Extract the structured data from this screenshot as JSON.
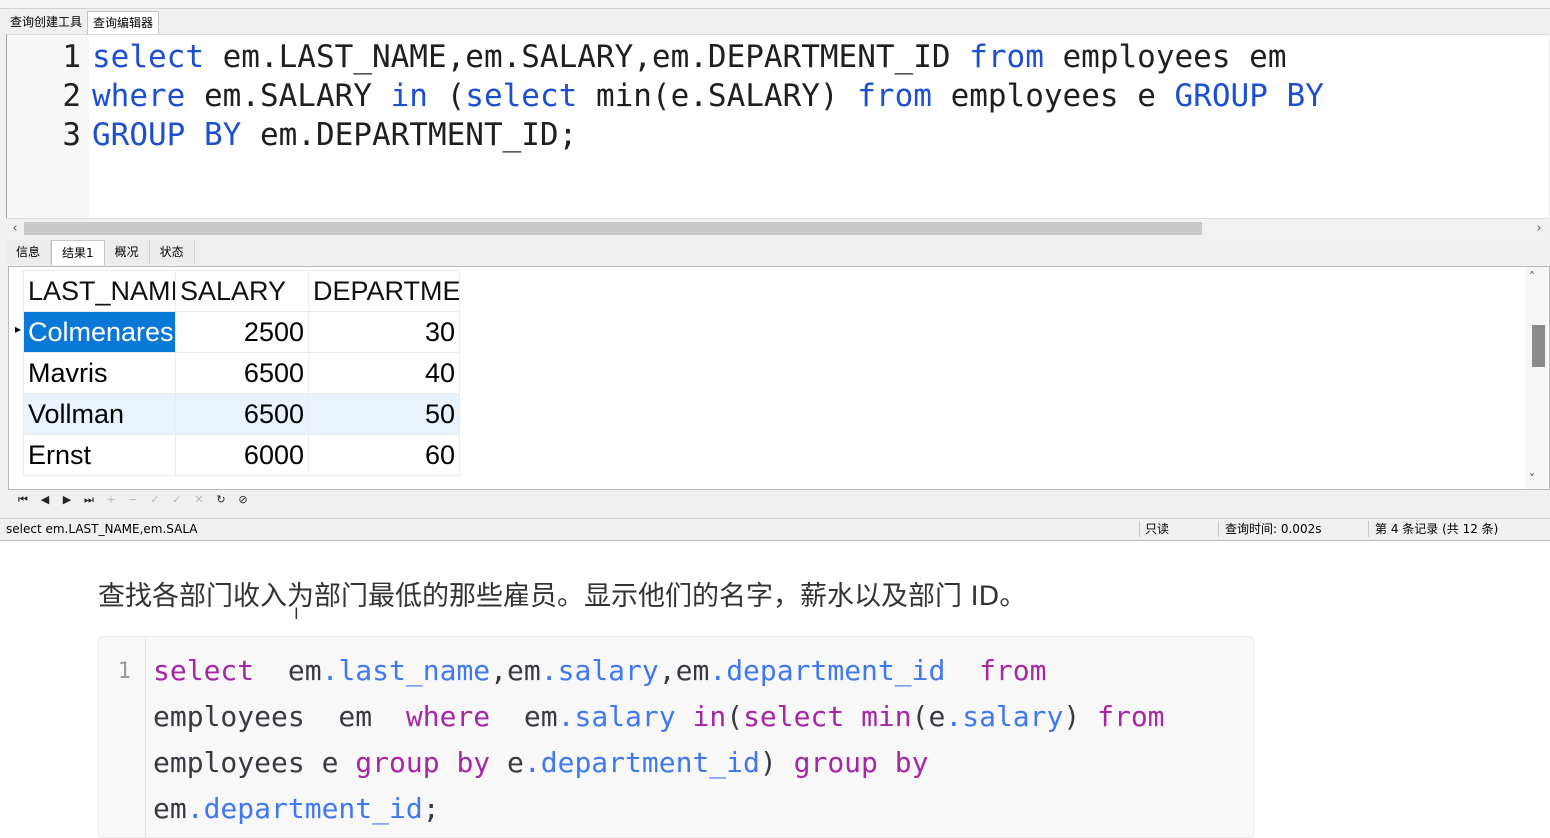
{
  "window": {
    "tabs": [
      "查询创建工具",
      "查询编辑器"
    ],
    "active_tab": 1
  },
  "editor": {
    "lines": [
      {
        "num": "1",
        "tokens": [
          {
            "t": "select",
            "k": true
          },
          {
            "t": " em.LAST_NAME,em.SALARY,em.DEPARTMENT_ID ",
            "k": false
          },
          {
            "t": "from",
            "k": true
          },
          {
            "t": " employees em",
            "k": false
          }
        ]
      },
      {
        "num": "2",
        "tokens": [
          {
            "t": "where",
            "k": true
          },
          {
            "t": " em.SALARY ",
            "k": false
          },
          {
            "t": "in",
            "k": true
          },
          {
            "t": " (",
            "k": false
          },
          {
            "t": "select",
            "k": true
          },
          {
            "t": " min(e.SALARY) ",
            "k": false
          },
          {
            "t": "from",
            "k": true
          },
          {
            "t": " employees e ",
            "k": false
          },
          {
            "t": "GROUP BY",
            "k": true
          }
        ]
      },
      {
        "num": "3",
        "tokens": [
          {
            "t": "GROUP BY",
            "k": true
          },
          {
            "t": " em.DEPARTMENT_ID;",
            "k": false
          }
        ]
      }
    ]
  },
  "result_tabs": [
    "信息",
    "结果1",
    "概况",
    "状态"
  ],
  "active_result_tab": 1,
  "grid": {
    "columns": [
      "LAST_NAMI",
      "SALARY",
      "DEPARTME"
    ],
    "rows": [
      [
        "Colmenares",
        "2500",
        "30"
      ],
      [
        "Mavris",
        "6500",
        "40"
      ],
      [
        "Vollman",
        "6500",
        "50"
      ],
      [
        "Ernst",
        "6000",
        "60"
      ]
    ]
  },
  "statusbar": {
    "sql": "select em.LAST_NAME,em.SALA",
    "mode": "只读",
    "query_time": "查询时间: 0.002s",
    "record": "第 4 条记录 (共 12 条)"
  },
  "article": {
    "description": "查找各部门收入为部门最低的那些雇员。显示他们的名字，薪水以及部门 ID。",
    "code_line_number": "1",
    "code_lines": [
      [
        {
          "t": "select",
          "c": "pk"
        },
        {
          "t": "  em",
          "c": "pp"
        },
        {
          "t": ".last_name",
          "c": "pb"
        },
        {
          "t": ",em",
          "c": "pp"
        },
        {
          "t": ".salary",
          "c": "pb"
        },
        {
          "t": ",em",
          "c": "pp"
        },
        {
          "t": ".department_id",
          "c": "pb"
        },
        {
          "t": "  ",
          "c": "pp"
        },
        {
          "t": "from",
          "c": "pk"
        }
      ],
      [
        {
          "t": "employees  em  ",
          "c": "pp"
        },
        {
          "t": "where",
          "c": "pk"
        },
        {
          "t": "  em",
          "c": "pp"
        },
        {
          "t": ".salary",
          "c": "pb"
        },
        {
          "t": " ",
          "c": "pp"
        },
        {
          "t": "in",
          "c": "pk"
        },
        {
          "t": "(",
          "c": "pp"
        },
        {
          "t": "select",
          "c": "pk"
        },
        {
          "t": " ",
          "c": "pp"
        },
        {
          "t": "min",
          "c": "pk"
        },
        {
          "t": "(e",
          "c": "pp"
        },
        {
          "t": ".salary",
          "c": "pb"
        },
        {
          "t": ") ",
          "c": "pp"
        },
        {
          "t": "from",
          "c": "pk"
        }
      ],
      [
        {
          "t": "employees e ",
          "c": "pp"
        },
        {
          "t": "group by",
          "c": "pk"
        },
        {
          "t": " e",
          "c": "pp"
        },
        {
          "t": ".department_id",
          "c": "pb"
        },
        {
          "t": ") ",
          "c": "pp"
        },
        {
          "t": "group by",
          "c": "pk"
        }
      ],
      [
        {
          "t": "em",
          "c": "pp"
        },
        {
          "t": ".department_id",
          "c": "pb"
        },
        {
          "t": ";",
          "c": "pp"
        }
      ]
    ]
  },
  "colors": {
    "keyword": "#1d4fd1",
    "selection": "#0a78d6",
    "code_purple": "#a626a4",
    "code_blue": "#4078f2"
  },
  "icons": [
    "first-record-icon",
    "prev-record-icon",
    "next-record-icon",
    "last-record-icon",
    "add-record-icon",
    "delete-record-icon",
    "apply-icon",
    "cancel-edit-icon",
    "clear-icon",
    "refresh-icon",
    "stop-icon"
  ]
}
